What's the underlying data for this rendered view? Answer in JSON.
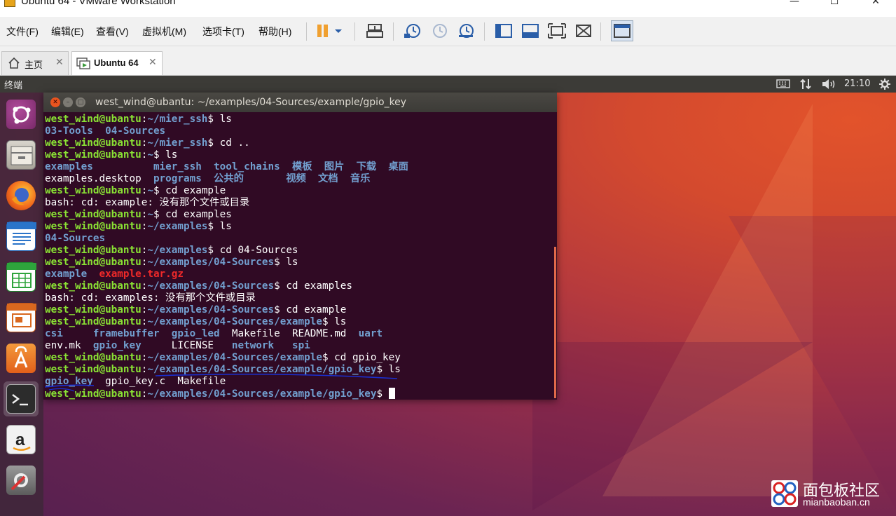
{
  "window": {
    "title": "Ubuntu 64 - VMware Workstation",
    "controls": {
      "minimize": "—",
      "maximize": "☐",
      "close": "✕"
    }
  },
  "menu": [
    "文件(F)",
    "编辑(E)",
    "查看(V)",
    "虚拟机(M)",
    "选项卡(T)",
    "帮助(H)"
  ],
  "toolbar": {
    "icons": [
      "pause-icon",
      "dropdown-icon",
      "send-ctrl-alt-del-icon",
      "snapshot-take-icon",
      "snapshot-revert-icon",
      "snapshot-manager-icon",
      "sidebar-icon",
      "console-view-icon",
      "full-screen-icon",
      "unity-icon",
      "thumbnail-view-icon"
    ]
  },
  "tabs": [
    {
      "label": "主页",
      "close": "✕",
      "icon": "home-icon"
    },
    {
      "label": "Ubuntu 64",
      "close": "✕",
      "icon": "vm-icon"
    }
  ],
  "guest_panel": {
    "title": "终端",
    "clock": "21:10",
    "tray": [
      "keyboard-icon",
      "network-icon",
      "volume-icon",
      "settings-icon"
    ]
  },
  "launcher": [
    "ubuntu-dash-icon",
    "files-icon",
    "firefox-icon",
    "writer-icon",
    "calc-icon",
    "impress-icon",
    "software-center-icon",
    "terminal-icon",
    "amazon-icon",
    "system-settings-icon"
  ],
  "terminal": {
    "title": "west_wind@ubantu: ~/examples/04-Sources/example/gpio_key",
    "lines": [
      [
        {
          "t": "west_wind@ubantu",
          "c": "u"
        },
        {
          "t": ":",
          "c": "w"
        },
        {
          "t": "~/mier_ssh",
          "c": "p"
        },
        {
          "t": "$ ls",
          "c": "w"
        }
      ],
      [
        {
          "t": "03-Tools",
          "c": "d"
        },
        {
          "t": "  ",
          "c": "w"
        },
        {
          "t": "04-Sources",
          "c": "d"
        }
      ],
      [
        {
          "t": "west_wind@ubantu",
          "c": "u"
        },
        {
          "t": ":",
          "c": "w"
        },
        {
          "t": "~/mier_ssh",
          "c": "p"
        },
        {
          "t": "$ cd ..",
          "c": "w"
        }
      ],
      [
        {
          "t": "west_wind@ubantu",
          "c": "u"
        },
        {
          "t": ":",
          "c": "w"
        },
        {
          "t": "~",
          "c": "p"
        },
        {
          "t": "$ ls",
          "c": "w"
        }
      ],
      [
        {
          "t": "examples",
          "c": "d"
        },
        {
          "t": "          ",
          "c": "w"
        },
        {
          "t": "mier_ssh",
          "c": "d"
        },
        {
          "t": "  ",
          "c": "w"
        },
        {
          "t": "tool_chains",
          "c": "d"
        },
        {
          "t": "  ",
          "c": "w"
        },
        {
          "t": "模板",
          "c": "d"
        },
        {
          "t": "  ",
          "c": "w"
        },
        {
          "t": "图片",
          "c": "d"
        },
        {
          "t": "  ",
          "c": "w"
        },
        {
          "t": "下载",
          "c": "d"
        },
        {
          "t": "  ",
          "c": "w"
        },
        {
          "t": "桌面",
          "c": "d"
        }
      ],
      [
        {
          "t": "examples.desktop",
          "c": "w"
        },
        {
          "t": "  ",
          "c": "w"
        },
        {
          "t": "programs",
          "c": "d"
        },
        {
          "t": "  ",
          "c": "w"
        },
        {
          "t": "公共的",
          "c": "d"
        },
        {
          "t": "       ",
          "c": "w"
        },
        {
          "t": "视频",
          "c": "d"
        },
        {
          "t": "  ",
          "c": "w"
        },
        {
          "t": "文档",
          "c": "d"
        },
        {
          "t": "  ",
          "c": "w"
        },
        {
          "t": "音乐",
          "c": "d"
        }
      ],
      [
        {
          "t": "west_wind@ubantu",
          "c": "u"
        },
        {
          "t": ":",
          "c": "w"
        },
        {
          "t": "~",
          "c": "p"
        },
        {
          "t": "$ cd example",
          "c": "w"
        }
      ],
      [
        {
          "t": "bash: cd: example: 没有那个文件或目录",
          "c": "w"
        }
      ],
      [
        {
          "t": "west_wind@ubantu",
          "c": "u"
        },
        {
          "t": ":",
          "c": "w"
        },
        {
          "t": "~",
          "c": "p"
        },
        {
          "t": "$ cd examples",
          "c": "w"
        }
      ],
      [
        {
          "t": "west_wind@ubantu",
          "c": "u"
        },
        {
          "t": ":",
          "c": "w"
        },
        {
          "t": "~/examples",
          "c": "p"
        },
        {
          "t": "$ ls",
          "c": "w"
        }
      ],
      [
        {
          "t": "04-Sources",
          "c": "d"
        }
      ],
      [
        {
          "t": "west_wind@ubantu",
          "c": "u"
        },
        {
          "t": ":",
          "c": "w"
        },
        {
          "t": "~/examples",
          "c": "p"
        },
        {
          "t": "$ cd 04-Sources",
          "c": "w"
        }
      ],
      [
        {
          "t": "west_wind@ubantu",
          "c": "u"
        },
        {
          "t": ":",
          "c": "w"
        },
        {
          "t": "~/examples/04-Sources",
          "c": "p"
        },
        {
          "t": "$ ls",
          "c": "w"
        }
      ],
      [
        {
          "t": "example",
          "c": "d"
        },
        {
          "t": "  ",
          "c": "w"
        },
        {
          "t": "example.tar.gz",
          "c": "r"
        }
      ],
      [
        {
          "t": "west_wind@ubantu",
          "c": "u"
        },
        {
          "t": ":",
          "c": "w"
        },
        {
          "t": "~/examples/04-Sources",
          "c": "p"
        },
        {
          "t": "$ cd examples",
          "c": "w"
        }
      ],
      [
        {
          "t": "bash: cd: examples: 没有那个文件或目录",
          "c": "w"
        }
      ],
      [
        {
          "t": "west_wind@ubantu",
          "c": "u"
        },
        {
          "t": ":",
          "c": "w"
        },
        {
          "t": "~/examples/04-Sources",
          "c": "p"
        },
        {
          "t": "$ cd example",
          "c": "w"
        }
      ],
      [
        {
          "t": "west_wind@ubantu",
          "c": "u"
        },
        {
          "t": ":",
          "c": "w"
        },
        {
          "t": "~/examples/04-Sources/example",
          "c": "p"
        },
        {
          "t": "$ ls",
          "c": "w"
        }
      ],
      [
        {
          "t": "csi",
          "c": "d"
        },
        {
          "t": "     ",
          "c": "w"
        },
        {
          "t": "framebuffer",
          "c": "d"
        },
        {
          "t": "  ",
          "c": "w"
        },
        {
          "t": "gpio_led",
          "c": "d"
        },
        {
          "t": "  Makefile  README.md  ",
          "c": "w"
        },
        {
          "t": "uart",
          "c": "d"
        }
      ],
      [
        {
          "t": "env.mk",
          "c": "w"
        },
        {
          "t": "  ",
          "c": "w"
        },
        {
          "t": "gpio_key",
          "c": "d"
        },
        {
          "t": "     LICENSE   ",
          "c": "w"
        },
        {
          "t": "network",
          "c": "d"
        },
        {
          "t": "   ",
          "c": "w"
        },
        {
          "t": "spi",
          "c": "d"
        }
      ],
      [
        {
          "t": "west_wind@ubantu",
          "c": "u"
        },
        {
          "t": ":",
          "c": "w"
        },
        {
          "t": "~/examples/04-Sources/example",
          "c": "p"
        },
        {
          "t": "$ cd gpio_key",
          "c": "w"
        }
      ],
      [
        {
          "t": "west_wind@ubantu",
          "c": "u"
        },
        {
          "t": ":",
          "c": "w"
        },
        {
          "t": "~/examples/04-Sources/example/gpio_key",
          "c": "p"
        },
        {
          "t": "$ ls",
          "c": "w"
        }
      ],
      [
        {
          "t": "gpio_key",
          "c": "d"
        },
        {
          "t": "  gpio_key.c  Makefile",
          "c": "w"
        }
      ],
      [
        {
          "t": "west_wind@ubantu",
          "c": "u"
        },
        {
          "t": ":",
          "c": "w"
        },
        {
          "t": "~/examples/04-Sources/example/gpio_key",
          "c": "p"
        },
        {
          "t": "$ ",
          "c": "w"
        }
      ]
    ]
  },
  "watermark": {
    "name": "面包板社区",
    "url": "mianbaoban.cn"
  },
  "colors": {
    "terminal_bg": "#300a24",
    "user": "#8ae234",
    "path": "#729fcf",
    "archive": "#ef2929",
    "panel": "#3c3b37",
    "annotation_stroke": "#1a2fd0"
  }
}
